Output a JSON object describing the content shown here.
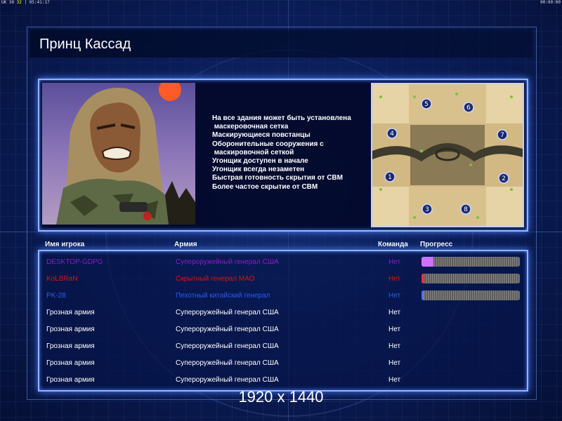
{
  "topbar": {
    "left_a": "UK 30 ",
    "left_y": "32",
    "left_b": "  | 05:41:17",
    "right": "00:00:00"
  },
  "title": "Принц Кассад",
  "features": [
    "На все здания может быть установлена",
    " маскеровочная сетка",
    "Маскирующиеся повстанцы",
    "Оборонительные сооружения с",
    " маскировочной сеткой",
    "Угонщик доступен в начале",
    "Угонщик всегда незаметен",
    "Быстрая готовность скрытия от СВМ",
    "Более частое скрытие от СВМ"
  ],
  "map": {
    "slots": [
      "1",
      "2",
      "3",
      "4",
      "5",
      "6",
      "7",
      "8"
    ]
  },
  "headers": {
    "name": "Имя игрока",
    "army": "Армия",
    "team": "Команда",
    "progress": "Прогресс"
  },
  "players": [
    {
      "name": "DESKTOP-GDPG",
      "army": "Супероружейный генерал США",
      "team": "Нет",
      "color": "#8a1cc8",
      "progress": 0.12,
      "fill": "#d070ff"
    },
    {
      "name": "KoLBRaN",
      "army": "Скрытный генерал МАО",
      "team": "Нет",
      "color": "#e01010",
      "progress": 0.03,
      "fill": "#ff3030"
    },
    {
      "name": "PK-28",
      "army": "Пехотный китайский генерал",
      "team": "Нет",
      "color": "#2a5cf0",
      "progress": 0.02,
      "fill": "#5070ff"
    },
    {
      "name": "Грозная армия",
      "army": "Супероружейный генерал США",
      "team": "Нет",
      "color": "#ffffff"
    },
    {
      "name": "Грозная армия",
      "army": "Супероружейный генерал США",
      "team": "Нет",
      "color": "#ffffff"
    },
    {
      "name": "Грозная армия",
      "army": "Супероружейный генерал США",
      "team": "Нет",
      "color": "#ffffff"
    },
    {
      "name": "Грозная армия",
      "army": "Супероружейный генерал США",
      "team": "Нет",
      "color": "#ffffff"
    },
    {
      "name": "Грозная армия",
      "army": "Супероружейный генерал США",
      "team": "Нет",
      "color": "#ffffff"
    }
  ],
  "team_color": "#ffffff",
  "resolution_label": "1920 x 1440"
}
